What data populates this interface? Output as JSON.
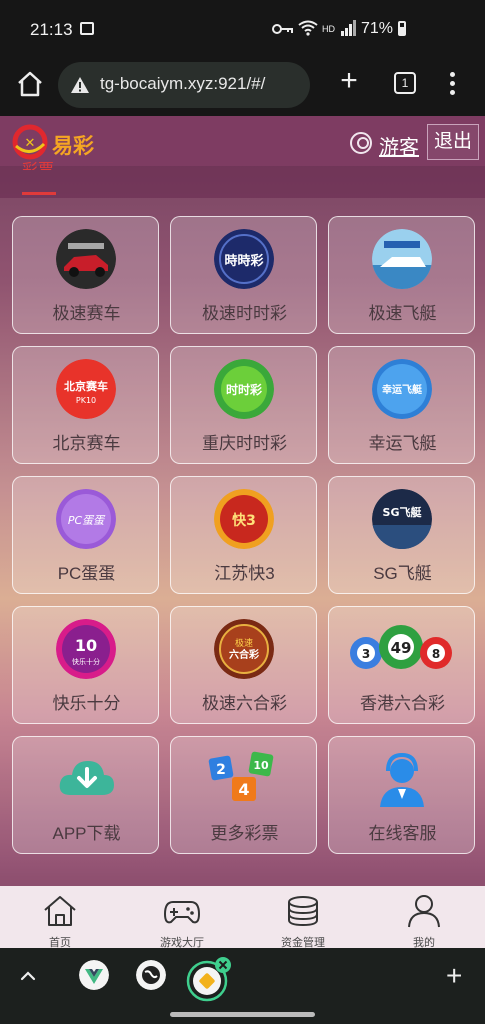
{
  "status_bar": {
    "time": "21:13",
    "network": "HD",
    "battery": "71%"
  },
  "browser": {
    "url": "tg-bocaiym.xyz:921/#/",
    "tab_count": "1"
  },
  "site": {
    "logo_text": "易彩",
    "guest_label": "游客",
    "logout_label": "退出",
    "active_tab": "彩票"
  },
  "games": [
    {
      "label": "极速赛车",
      "icon": "racing-car-icon"
    },
    {
      "label": "极速时时彩",
      "icon": "speed-lottery-icon"
    },
    {
      "label": "极速飞艇",
      "icon": "speed-boat-icon"
    },
    {
      "label": "北京赛车",
      "icon": "beijing-racing-icon"
    },
    {
      "label": "重庆时时彩",
      "icon": "chongqing-lottery-icon"
    },
    {
      "label": "幸运飞艇",
      "icon": "lucky-airship-icon"
    },
    {
      "label": "PC蛋蛋",
      "icon": "pc-egg-icon"
    },
    {
      "label": "江苏快3",
      "icon": "jiangsu-dice-icon"
    },
    {
      "label": "SG飞艇",
      "icon": "sg-airship-icon"
    },
    {
      "label": "快乐十分",
      "icon": "happy-ten-icon"
    },
    {
      "label": "极速六合彩",
      "icon": "speed-mark-six-icon"
    },
    {
      "label": "香港六合彩",
      "icon": "hongkong-mark-six-icon"
    },
    {
      "label": "APP下载",
      "icon": "cloud-download-icon"
    },
    {
      "label": "更多彩票",
      "icon": "more-lottery-icon"
    },
    {
      "label": "在线客服",
      "icon": "customer-service-icon"
    }
  ],
  "icon_text": {
    "speed_lottery": "時時彩",
    "beijing": "北京赛车",
    "beijing_sub": "PK10",
    "chongqing": "时时彩",
    "lucky": "幸运飞艇",
    "pc": "PC蛋蛋",
    "jiangsu": "快3",
    "sg": "SG飞艇",
    "happy": "10",
    "happy_sub": "快乐十分",
    "mark_six": "极速",
    "mark_six_sub": "六合彩",
    "hk_balls": [
      "3",
      "49",
      "8"
    ],
    "more_tiles": [
      "2",
      "10",
      "4"
    ]
  },
  "bottom_nav": [
    {
      "label": "首页",
      "icon": "home-icon"
    },
    {
      "label": "游戏大厅",
      "icon": "gamepad-icon"
    },
    {
      "label": "资金管理",
      "icon": "coins-icon"
    },
    {
      "label": "我的",
      "icon": "profile-icon"
    }
  ],
  "colors": {
    "brand": "#f5a623",
    "accent_red": "#e03a3a",
    "header": "#7e3c62"
  }
}
